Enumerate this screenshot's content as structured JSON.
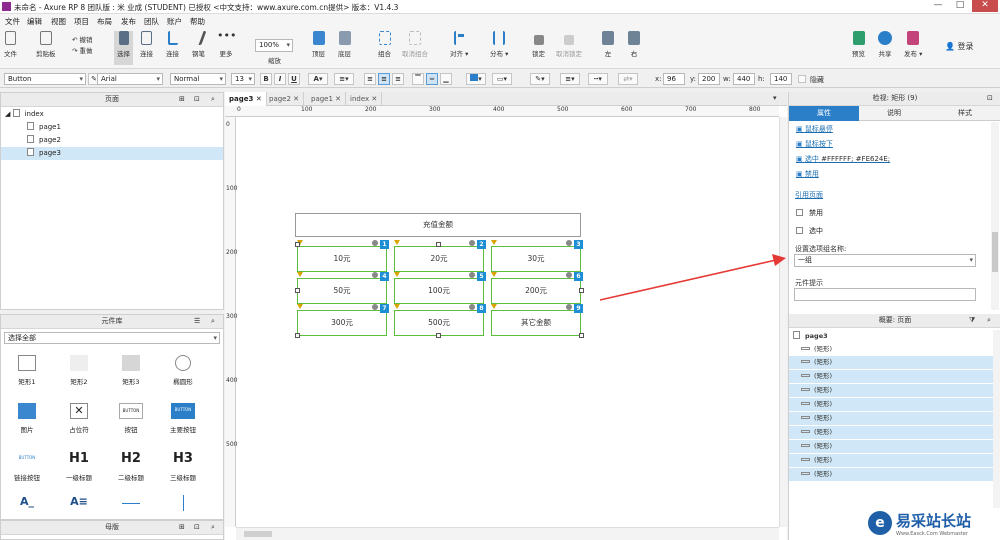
{
  "window": {
    "title": "未命名 - Axure RP 8 团队版 : 米 业成 (STUDENT) 已授权   <中文支持：www.axure.com.cn提供> 版本：V1.4.3",
    "min": "—",
    "max": "□",
    "close": "✕"
  },
  "menu": [
    "文件",
    "编辑",
    "视图",
    "项目",
    "布局",
    "发布",
    "团队",
    "账户",
    "帮助"
  ],
  "toolbar": {
    "file": "文件",
    "clipboard": "剪贴板",
    "undo": "撤销",
    "redo": "重做",
    "select": "选择",
    "connect": "连接",
    "pen": "钢笔",
    "more": "更多",
    "zoom_value": "100%",
    "zoom": "缩放",
    "top": "顶层",
    "bottom": "底层",
    "group": "组合",
    "ungroup": "取消组合",
    "align": "对齐",
    "distribute": "分布",
    "lock": "锁定",
    "unlock": "取消锁定",
    "left": "左",
    "right": "右",
    "preview": "预览",
    "share": "共享",
    "publish": "发布",
    "login": "登录"
  },
  "format": {
    "style": "Button",
    "font": "Arial",
    "weight": "Normal",
    "size": "13",
    "x_label": "x:",
    "x": "96",
    "y_label": "y:",
    "y": "200",
    "w_label": "w:",
    "w": "440",
    "h_label": "h:",
    "h": "140",
    "hide": "隐藏"
  },
  "pages_panel": {
    "title": "页面",
    "root": "index",
    "pages": [
      "page1",
      "page2",
      "page3"
    ],
    "selected": "page3"
  },
  "library": {
    "title": "元件库",
    "selector": "选择全部",
    "items": [
      "矩形1",
      "矩形2",
      "矩形3",
      "椭圆形",
      "图片",
      "占位符",
      "按钮",
      "主要按钮",
      "链接按钮",
      "一级标题",
      "二级标题",
      "三级标题"
    ],
    "btn_small": "BUTTON",
    "h1": "H1",
    "h2": "H2",
    "h3": "H3"
  },
  "masters": {
    "title": "母版"
  },
  "tabs": [
    "page3",
    "page2",
    "page1",
    "index"
  ],
  "ruler": {
    "h": [
      "0",
      "100",
      "200",
      "300",
      "400",
      "500",
      "600",
      "700",
      "800"
    ],
    "v": [
      "0",
      "100",
      "200",
      "300",
      "400",
      "500"
    ]
  },
  "widget": {
    "title": "充值金额",
    "options": [
      {
        "label": "10元",
        "num": "1"
      },
      {
        "label": "20元",
        "num": "2"
      },
      {
        "label": "30元",
        "num": "3"
      },
      {
        "label": "50元",
        "num": "4"
      },
      {
        "label": "100元",
        "num": "5"
      },
      {
        "label": "200元",
        "num": "6"
      },
      {
        "label": "300元",
        "num": "7"
      },
      {
        "label": "500元",
        "num": "8"
      },
      {
        "label": "其它金额",
        "num": "9"
      }
    ]
  },
  "inspector": {
    "title": "检视: 矩形 (9)",
    "tabs": [
      "属性",
      "说明",
      "样式"
    ],
    "link_hover": "鼠标悬停",
    "link_down": "鼠标按下",
    "link_selected": "选中",
    "selected_value": "#FFFFFF; #FE624E;",
    "link_disabled": "禁用",
    "ref_page": "引用页面",
    "disabled": "禁用",
    "selected": "选中",
    "group_label": "设置选项组名称:",
    "group_value": "一组",
    "tip_label": "元件提示",
    "tip_value": ""
  },
  "outline": {
    "title": "概要: 页面",
    "page": "page3",
    "item": "(矩形)",
    "count": 9
  },
  "watermark": {
    "text": "易采站长站",
    "sub": "Www.Easck.Com Webmaster"
  },
  "colors": {
    "accent": "#1e8fd5",
    "green_border": "#5cbf3c",
    "arrow": "#e53935",
    "selected_row": "#cfe7f6",
    "purple": "#8e2b8e"
  }
}
